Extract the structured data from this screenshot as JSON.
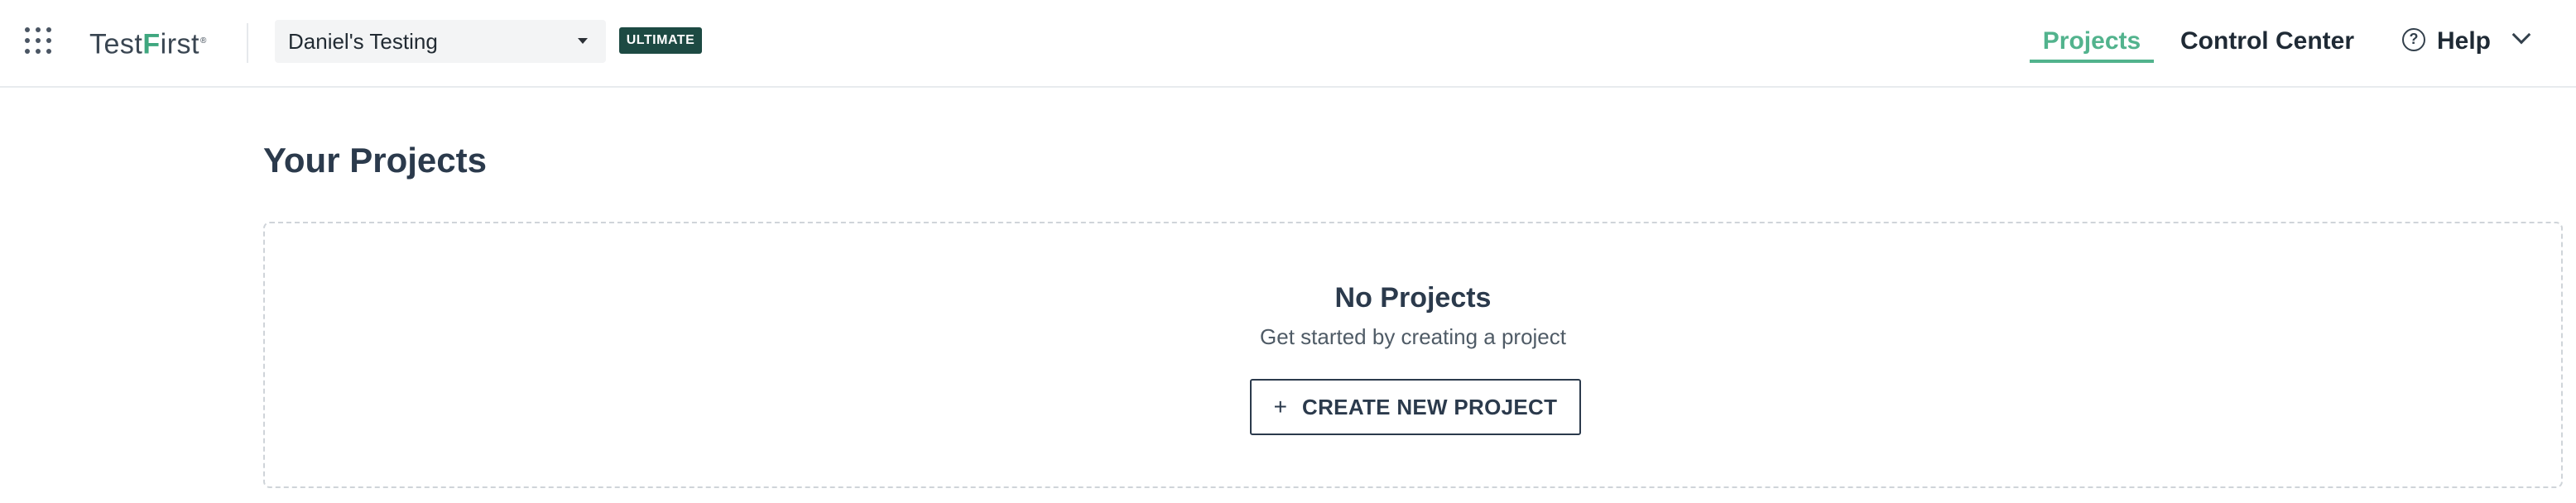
{
  "header": {
    "apps_icon": "grid-dots-icon",
    "logo": {
      "part1": "Test",
      "accent": "F",
      "part2": "irst",
      "mark": "®"
    },
    "workspace": {
      "label": "Daniel's Testing"
    },
    "plan_badge": "ULTIMATE",
    "nav": {
      "projects": "Projects",
      "control_center": "Control Center",
      "help": "Help"
    },
    "colors": {
      "accent": "#52b38d",
      "badge_bg": "#1d4a43"
    }
  },
  "main": {
    "title": "Your Projects",
    "empty_state": {
      "title": "No Projects",
      "subtitle": "Get started by creating a project",
      "button_icon": "+",
      "button_label": "CREATE NEW PROJECT"
    }
  }
}
